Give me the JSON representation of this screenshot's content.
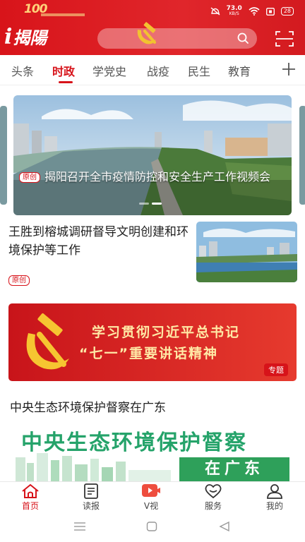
{
  "status_bar": {
    "net_speed": "73.0",
    "net_unit": "KB/S",
    "battery": "28",
    "centenary_badge": "100"
  },
  "header": {
    "logo_text": "揭陽",
    "logo_letter": "i"
  },
  "tabs": [
    {
      "label": "头条",
      "active": false
    },
    {
      "label": "时政",
      "active": true
    },
    {
      "label": "学党史",
      "active": false
    },
    {
      "label": "战疫",
      "active": false
    },
    {
      "label": "民生",
      "active": false
    },
    {
      "label": "教育",
      "active": false
    }
  ],
  "carousel": {
    "badge": "原创",
    "title": "揭阳召开全市疫情防控和安全生产工作视频会",
    "slides": 2,
    "current_slide": 2
  },
  "feed": {
    "item1": {
      "title": "王胜到榕城调研督导文明创建和环境保护等工作",
      "badge": "原创"
    },
    "banner": {
      "line1": "学习贯彻习近平总书记",
      "line2": "“七一”重要讲话精神",
      "tag": "专题"
    },
    "item2": {
      "title": "中央生态环境保护督察在广东",
      "poster_title": "中央生态环境保护督察",
      "poster_tag": "在广东"
    }
  },
  "bottom_nav": [
    {
      "label": "首页",
      "icon": "home-icon",
      "active": true
    },
    {
      "label": "读报",
      "icon": "newspaper-icon",
      "active": false
    },
    {
      "label": "V视",
      "icon": "video-icon",
      "active": false
    },
    {
      "label": "服务",
      "icon": "heart-icon",
      "active": false
    },
    {
      "label": "我的",
      "icon": "user-icon",
      "active": false
    }
  ],
  "colors": {
    "brand_red": "#d7131a",
    "banner_text": "#ffe9a6",
    "poster_green": "#25a36a"
  }
}
